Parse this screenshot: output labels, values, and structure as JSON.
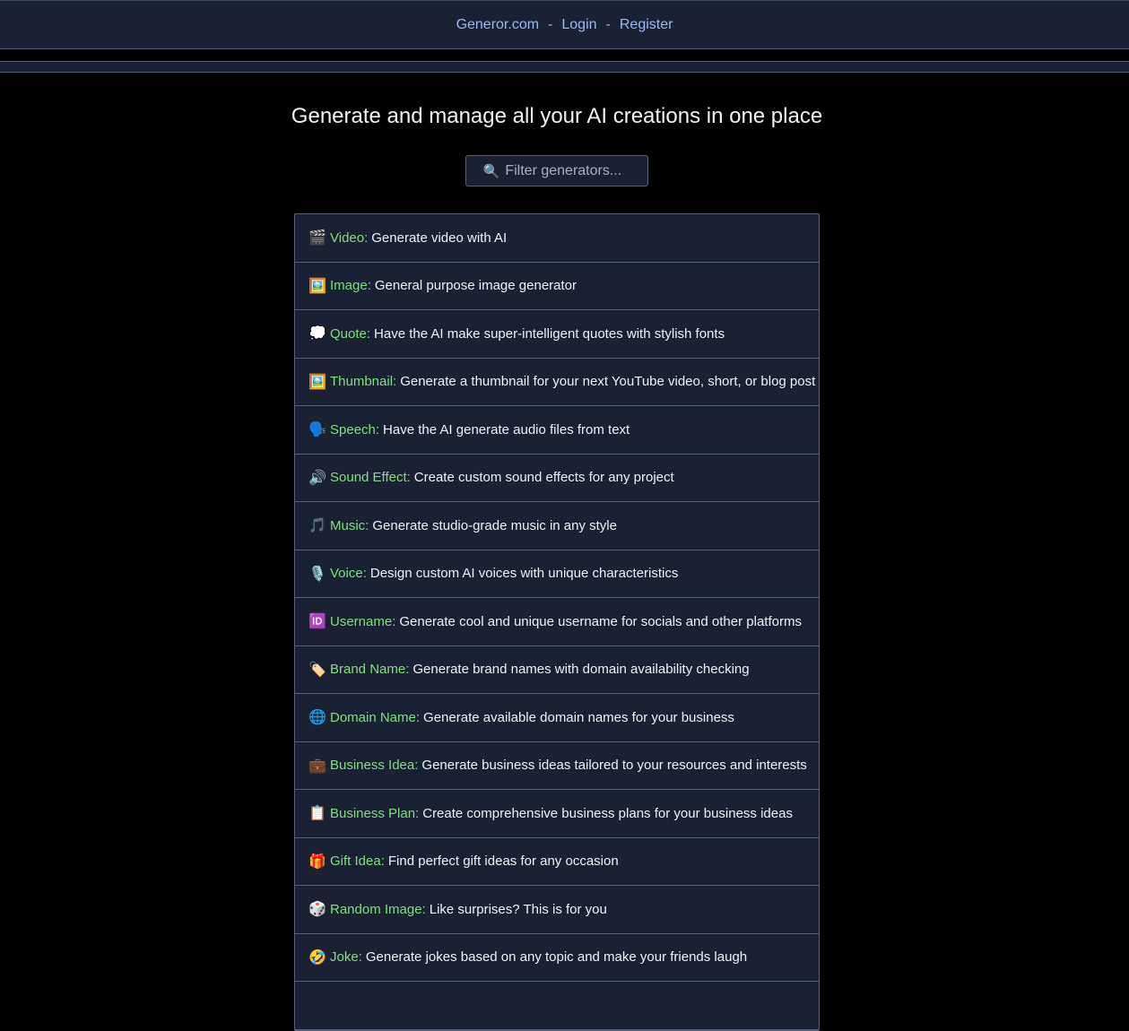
{
  "nav": {
    "home": "Generor.com",
    "separator": "-",
    "login": "Login",
    "register": "Register"
  },
  "headline": "Generate and manage all your AI creations in one place",
  "search": {
    "icon": "🔍",
    "placeholder": "Filter generators..."
  },
  "generators": [
    {
      "emoji": "🎬",
      "name": "Video:",
      "desc": "Generate video with AI"
    },
    {
      "emoji": "🖼️",
      "name": "Image:",
      "desc": "General purpose image generator"
    },
    {
      "emoji": "💭",
      "name": "Quote:",
      "desc": "Have the AI make super-intelligent quotes with stylish fonts"
    },
    {
      "emoji": "🖼️",
      "name": "Thumbnail:",
      "desc": "Generate a thumbnail for your next YouTube video, short, or blog post"
    },
    {
      "emoji": "🗣️",
      "name": "Speech:",
      "desc": "Have the AI generate audio files from text"
    },
    {
      "emoji": "🔊",
      "name": "Sound Effect:",
      "desc": "Create custom sound effects for any project"
    },
    {
      "emoji": "🎵",
      "name": "Music:",
      "desc": "Generate studio-grade music in any style"
    },
    {
      "emoji": "🎙️",
      "name": "Voice:",
      "desc": "Design custom AI voices with unique characteristics"
    },
    {
      "emoji": "🆔",
      "name": "Username:",
      "desc": "Generate cool and unique username for socials and other platforms"
    },
    {
      "emoji": "🏷️",
      "name": "Brand Name:",
      "desc": "Generate brand names with domain availability checking"
    },
    {
      "emoji": "🌐",
      "name": "Domain Name:",
      "desc": "Generate available domain names for your business"
    },
    {
      "emoji": "💼",
      "name": "Business Idea:",
      "desc": "Generate business ideas tailored to your resources and interests"
    },
    {
      "emoji": "📋",
      "name": "Business Plan:",
      "desc": "Create comprehensive business plans for your business ideas"
    },
    {
      "emoji": "🎁",
      "name": "Gift Idea:",
      "desc": "Find perfect gift ideas for any occasion"
    },
    {
      "emoji": "🎲",
      "name": "Random Image:",
      "desc": "Like surprises? This is for you"
    },
    {
      "emoji": "🤣",
      "name": "Joke:",
      "desc": "Generate jokes based on any topic and make your friends laugh"
    },
    {
      "emoji": "",
      "name": "",
      "desc": ""
    }
  ]
}
